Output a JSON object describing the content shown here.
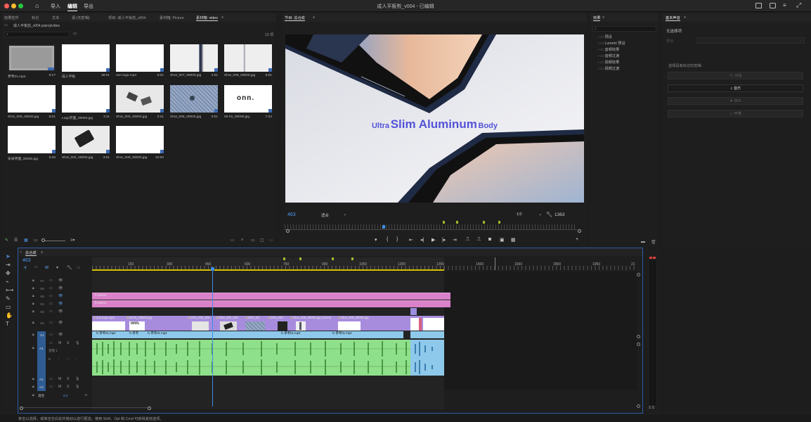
{
  "titlebar": {
    "title": "成人平板剪_v004 - 已编辑",
    "nav": [
      "导入",
      "编辑",
      "导出"
    ],
    "active_nav": "编辑"
  },
  "project": {
    "tabs": [
      "效果控件",
      "标记",
      "文本",
      "源:(无剪辑)",
      "项目: 成人平板剪_v004",
      "素材箱: Picture",
      "素材箱: video"
    ],
    "path": "成人平板剪_v004.prproj\\video",
    "count": "13 项",
    "items": [
      {
        "name": "参考01.mp4",
        "dur": "9:17"
      },
      {
        "name": "成人平板",
        "dur": "38:01"
      },
      {
        "name": "onn logo.mp4",
        "dur": "6:01"
      },
      {
        "name": "Shot_007_00000.jpg",
        "dur": "4:01"
      },
      {
        "name": "Shot_008_00000.jpg",
        "dur": "5:01"
      },
      {
        "name": "Shot_009_00000.jpg",
        "dur": "8:01"
      },
      {
        "name": "Logo页面_00000.jpg",
        "dur": "3:11"
      },
      {
        "name": "Shot_003_00000.jpg",
        "dur": "3:21"
      },
      {
        "name": "Shot_006_00000.jpg",
        "dur": "3:01"
      },
      {
        "name": "00-01_00000.jpg",
        "dur": "7:24"
      },
      {
        "name": "安卓界面_00000.jpg",
        "dur": "0:26"
      },
      {
        "name": "Shot_002_00000.jpg",
        "dur": "3:01"
      },
      {
        "name": "Shot_009_00000.jpg",
        "dur": "10:00"
      }
    ]
  },
  "program": {
    "tab": "节目: 总合成",
    "caption_small1": "Ultra",
    "caption_big": "Slim Aluminum",
    "caption_small2": "Body",
    "timecode": "463",
    "fit": "适合",
    "resolution": "1/2",
    "duration": "1363"
  },
  "effects": {
    "tab": "效果",
    "items": [
      "预设",
      "Lumetri 预设",
      "音频效果",
      "音频过渡",
      "视频效果",
      "视频过渡"
    ]
  },
  "essential_sound": {
    "tab": "基本声音",
    "no_selection": "无选择项",
    "preset_label": "预设",
    "hint": "选择具有标记的剪辑:",
    "buttons": [
      "对话",
      "音乐",
      "SFX",
      "环境"
    ],
    "active": "音乐"
  },
  "timeline": {
    "tab": "总合成",
    "timecode": "463",
    "ruler": [
      "150",
      "300",
      "450",
      "600",
      "750",
      "900",
      "1050",
      "1200",
      "1350",
      "1500",
      "1650",
      "1800",
      "1950",
      "21"
    ],
    "tracks": {
      "v": [
        "V7",
        "V6",
        "V5",
        "V4",
        "V3",
        "V2",
        "V1"
      ],
      "a": [
        "A1",
        "A2",
        "A3"
      ],
      "mix": "混合",
      "mix_val": "0.0",
      "a1_name": "音频 1",
      "a1_val": "0."
    },
    "clips": {
      "demo": "Demo",
      "v2": [
        "onn logo.mp4",
        "00-01_00000.jpg",
        "Shot_003_000",
        "Shot_002_000",
        "Shot_00",
        "Shot_007",
        "Shot_008_00000.jpg [115%]",
        "Shot_009_00000.jpg"
      ],
      "v1": [
        "参考01.mp4",
        "参考",
        "参考01.mp4",
        "参考01.mp4",
        "参考01.mp4"
      ]
    }
  },
  "status": {
    "text": "单击以选择，或单击空白处并拖动以进行框选。使用 Shift、Opt 和 Cmd 可获得其他选项。"
  },
  "meter": {
    "label": "S S"
  },
  "colors": {
    "accent": "#2d8ceb",
    "video_clip": "#a78cde",
    "pink_clip": "#e070c0",
    "audio_clip": "#7ee07a",
    "v1_clip": "#8ec8ea",
    "caption_blue": "#5353d8"
  }
}
